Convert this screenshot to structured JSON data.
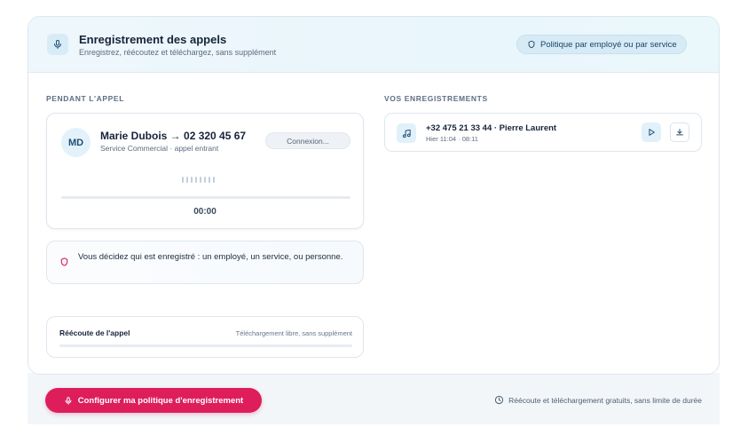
{
  "header": {
    "title": "Enregistrement des appels",
    "subtitle": "Enregistrez, réécoutez et téléchargez, sans supplément",
    "policy_badge": "Politique par employé ou par service",
    "icon": "microphone-icon"
  },
  "live_call": {
    "section_label": "PENDANT L'APPEL",
    "avatar_initials": "MD",
    "caller": "Marie Dubois → 02 320 45 67",
    "caller_sub": "Service Commercial · appel entrant",
    "status": "Connexion...",
    "timer": "00:00",
    "progress": 0
  },
  "notice": {
    "icon": "shield-icon",
    "text": "Vous décidez qui est enregistré : un employé, un service, ou personne."
  },
  "replay": {
    "title": "Réécoute de l'appel",
    "note": "Téléchargement libre, sans supplément",
    "progress": 0
  },
  "recordings": {
    "section_label": "VOS ENREGISTREMENTS",
    "items": [
      {
        "title": "+32 475 21 33 44 · Pierre Laurent",
        "meta": "Hier 11:04 · 08:11",
        "icon": "music-note-icon"
      }
    ]
  },
  "footer": {
    "cta_label": "Configurer ma politique d'enregistrement",
    "note": "Réécoute et téléchargement gratuits, sans limite de durée"
  },
  "colors": {
    "accent": "#dd1e5a",
    "brand_blue": "#1f4e73",
    "header_bg": "#eaf6fb"
  }
}
